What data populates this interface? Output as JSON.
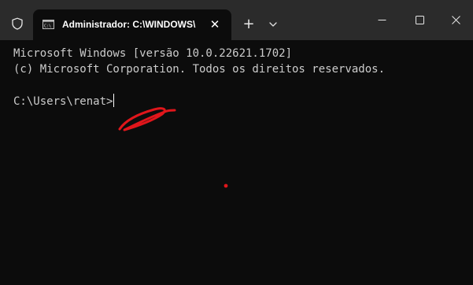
{
  "titlebar": {
    "tab_title": "Administrador: C:\\WINDOWS\\",
    "tab_close_glyph": "✕",
    "new_tab_glyph": "+",
    "icons": {
      "shield": "shield-icon",
      "tab": "cmd-icon",
      "dropdown": "chevron-down-icon",
      "minimize": "minimize-icon",
      "maximize": "maximize-icon",
      "close": "close-icon"
    }
  },
  "terminal": {
    "line1": "Microsoft Windows [versão 10.0.22621.1702]",
    "line2": "(c) Microsoft Corporation. Todos os direitos reservados.",
    "prompt": "C:\\Users\\renat>"
  },
  "colors": {
    "titlebar_bg": "#2b2b2b",
    "terminal_bg": "#0c0c0c",
    "terminal_text": "#cccccc",
    "annotation": "#e0161b"
  }
}
